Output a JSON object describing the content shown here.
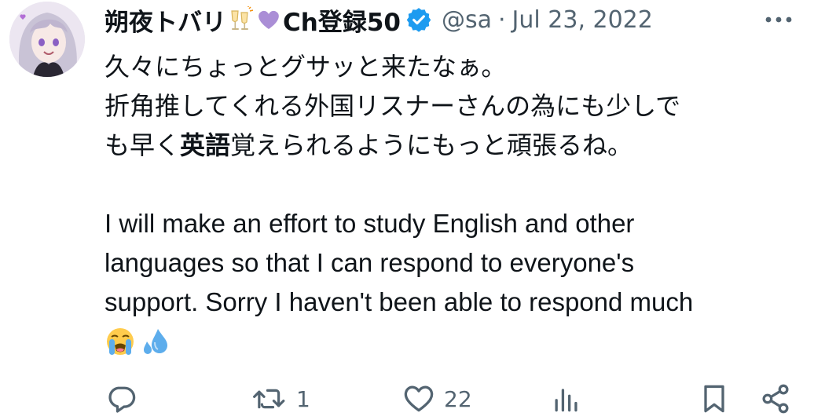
{
  "author": {
    "display_name": "朔夜トバリ",
    "name_suffix": "Ch登録50",
    "handle": "@sa",
    "separator": "·",
    "date": "Jul 23, 2022"
  },
  "tweet": {
    "line1": "久々にちょっとグサッと来たなぁ。",
    "line2": "折角推してくれる外国リスナーさんの為にも少しで",
    "line3_pre": "も早く",
    "line3_bold": "英語",
    "line3_post": "覚えられるようにもっと頑張るね。",
    "en_line1": "I will make an effort to study English and other",
    "en_line2": "languages so that I can respond to everyone's",
    "en_line3": "support. Sorry I haven't been able to respond much"
  },
  "actions": {
    "reply_count": "",
    "retweet_count": "1",
    "like_count": "22"
  },
  "icons": {
    "name_emojis": [
      "clinking-glasses-icon",
      "purple-heart-icon"
    ],
    "verified": "verified-badge-icon",
    "more": "more-icon",
    "tail_emojis": [
      "loudly-crying-face-icon",
      "sweat-droplets-icon"
    ],
    "reply": "reply-icon",
    "retweet": "retweet-icon",
    "like": "heart-icon",
    "views": "analytics-icon",
    "bookmark": "bookmark-icon",
    "share": "share-icon"
  },
  "colors": {
    "text": "#0f1419",
    "muted": "#536471",
    "verified": "#1d9bf0",
    "purple_heart": "#aa8ed6"
  }
}
